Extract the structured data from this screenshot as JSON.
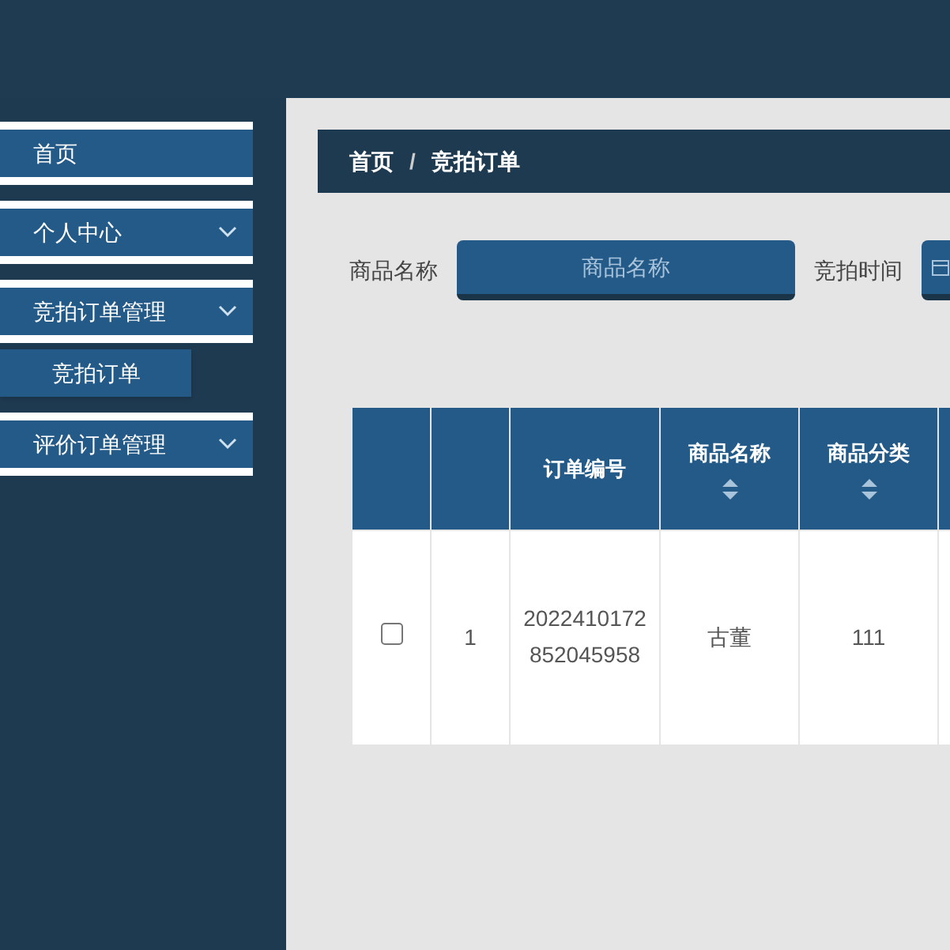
{
  "sidebar": {
    "items": [
      {
        "label": "首页",
        "expandable": false
      },
      {
        "label": "个人中心",
        "expandable": true
      },
      {
        "label": "竞拍订单管理",
        "expandable": true,
        "children": [
          {
            "label": "竞拍订单",
            "selected": true
          }
        ]
      },
      {
        "label": "评价订单管理",
        "expandable": true
      }
    ]
  },
  "breadcrumb": [
    "首页",
    "竞拍订单"
  ],
  "breadcrumb_separator": "/",
  "search": [
    {
      "label": "商品名称",
      "placeholder": "商品名称",
      "kind": "text"
    },
    {
      "label": "竞拍时间",
      "kind": "date"
    }
  ],
  "table": {
    "columns": [
      {
        "kind": "check",
        "sortable": false
      },
      {
        "sortable": false
      },
      {
        "label": "订单编号",
        "sortable": false
      },
      {
        "label": "商品名称",
        "sortable": true
      },
      {
        "label": "商品分类",
        "sortable": true
      },
      {
        "sortable": false
      }
    ],
    "rows": [
      {
        "checked": false,
        "cells": [
          "",
          "1",
          "2022410172852045958",
          "古董",
          "111"
        ]
      }
    ]
  }
}
